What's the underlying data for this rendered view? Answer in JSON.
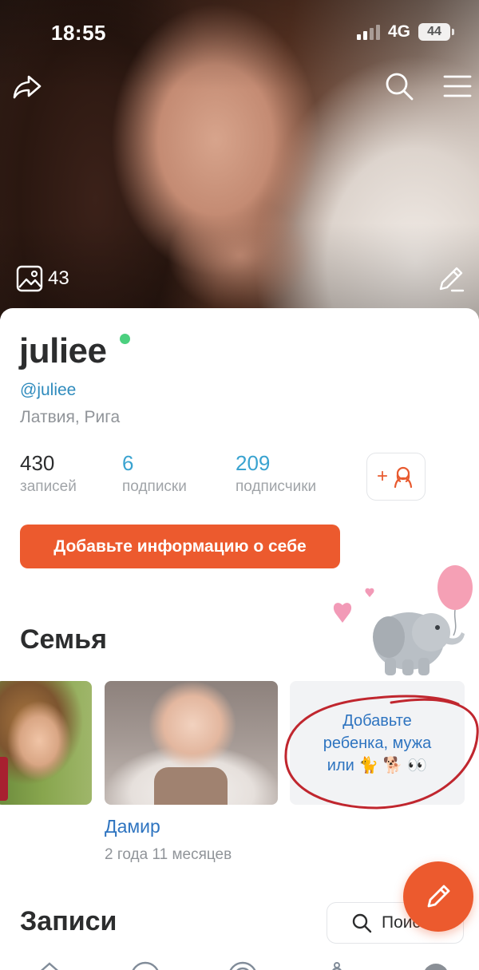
{
  "status_bar": {
    "time": "18:55",
    "network": "4G",
    "battery": "44"
  },
  "cover": {
    "photo_count": "43",
    "icons": [
      "share-icon",
      "search-icon",
      "menu-icon",
      "photos-icon",
      "edit-icon"
    ]
  },
  "profile": {
    "name": "juliee",
    "online": true,
    "handle": "@juliee",
    "location": "Латвия, Рига"
  },
  "stats": [
    {
      "value": "430",
      "label": "записей"
    },
    {
      "value": "6",
      "label": "подписки"
    },
    {
      "value": "209",
      "label": "подписчики"
    }
  ],
  "add_friend": {
    "plus": "+",
    "icon": "person-icon"
  },
  "info_button": "Добавьте информацию о себе",
  "family": {
    "title": "Семья",
    "members": [
      {
        "name": "Дамир",
        "age": "2 года 11 месяцев"
      }
    ],
    "add_card_text": "Добавьте\nребенка, мужа\nили 🐈 🐕 👀"
  },
  "posts": {
    "title": "Записи",
    "search_label": "Поиск"
  },
  "colors": {
    "accent": "#ec5a2e",
    "link": "#2e74c0",
    "stat_link": "#3aa3d0",
    "online": "#4bd07f",
    "muted": "#909499"
  }
}
